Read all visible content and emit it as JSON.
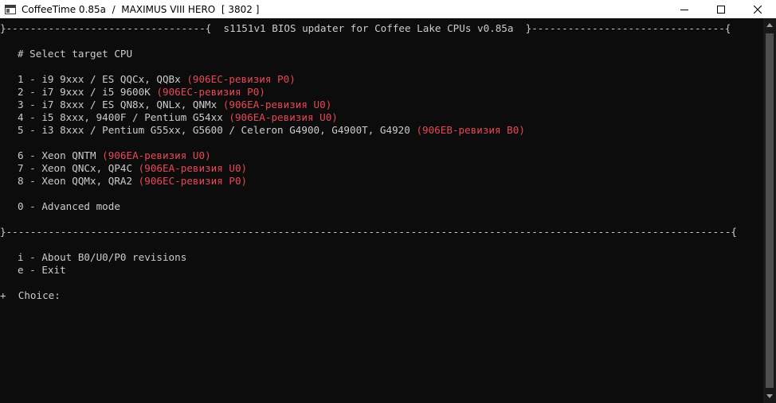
{
  "window": {
    "title": "CoffeeTime 0.85a  /  MAXIMUS VIII HERO  [ 3802 ]",
    "icon": "console-window-icon",
    "controls": [
      "minimize-icon",
      "maximize-icon",
      "close-icon"
    ]
  },
  "console": {
    "header_border": "}---------------------------------{  s1151v1 BIOS updater for Coffee Lake CPUs v0.85a  }--------------------------------{",
    "prompt": "# Select target CPU",
    "cpu_options": [
      {
        "text": "1 - i9 9xxx / ES QQCx, QQBx",
        "revision": "(906EC-ревизия P0)"
      },
      {
        "text": "2 - i7 9xxx / i5 9600K",
        "revision": "(906EC-ревизия P0)"
      },
      {
        "text": "3 - i7 8xxx / ES QN8x, QNLx, QNMx",
        "revision": "(906EA-ревизия U0)"
      },
      {
        "text": "4 - i5 8xxx, 9400F / Pentium G54xx",
        "revision": "(906EA-ревизия U0)"
      },
      {
        "text": "5 - i3 8xxx / Pentium G55xx, G5600 / Celeron G4900, G4900T, G4920",
        "revision": "(906EB-ревизия B0)"
      }
    ],
    "xeon_options": [
      {
        "text": "6 - Xeon QNTM",
        "revision": "(906EA-ревизия U0)"
      },
      {
        "text": "7 - Xeon QNCx, QP4C",
        "revision": "(906EA-ревизия U0)"
      },
      {
        "text": "8 - Xeon QQMx, QRA2",
        "revision": "(906EC-ревизия P0)"
      }
    ],
    "advanced": "0 - Advanced mode",
    "separator": "}------------------------------------------------------------------------------------------------------------------------{",
    "about": "i - About B0/U0/P0 revisions",
    "exit": "e - Exit",
    "choice": "+  Choice:"
  },
  "colors": {
    "background": "#0c0c0c",
    "text": "#cccccc",
    "revision": "#e74856"
  }
}
